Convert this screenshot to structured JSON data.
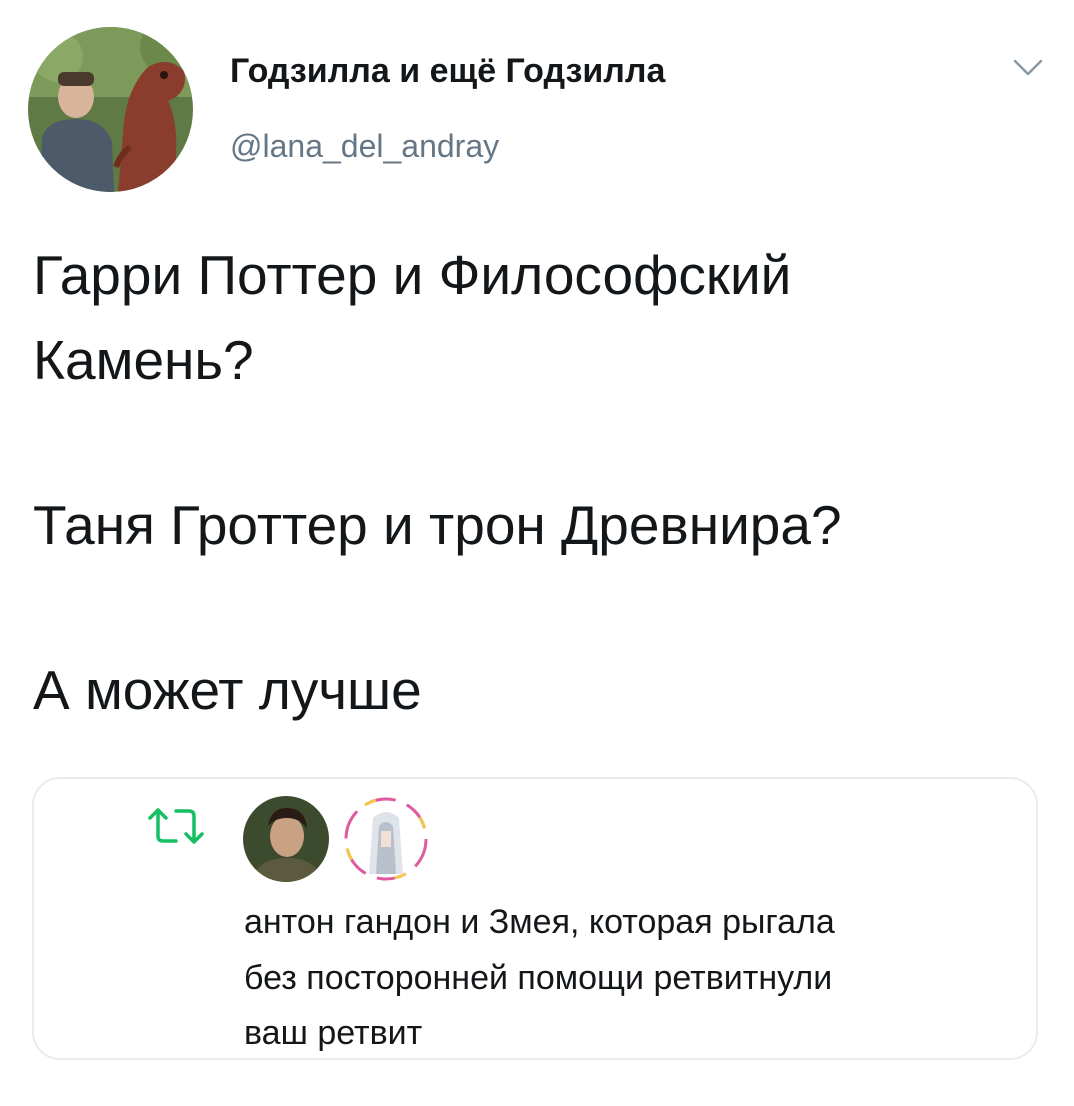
{
  "header": {
    "display_name": "Годзилла и ещё Годзилла",
    "handle": "@lana_del_andray",
    "avatar_icon": "user-photo-with-dinosaur-statue",
    "menu_icon": "chevron-down-icon"
  },
  "tweet": {
    "lines": [
      "Гарри Поттер и Философский",
      "Камень?",
      "Таня Гроттер и трон Древнира?",
      "А может лучше"
    ]
  },
  "social_context": {
    "icon": "retweet-icon",
    "icon_color": "#17bf63",
    "avatars": [
      "avatar-user-1",
      "avatar-user-2"
    ],
    "text_lines": [
      "антон гандон и Змея, которая рыгала",
      "без посторонней помощи ретвитнули",
      "ваш ретвит"
    ]
  },
  "colors": {
    "text": "#14171a",
    "secondary_text": "#657786",
    "border": "#e6ecf0",
    "retweet_green": "#17bf63"
  }
}
